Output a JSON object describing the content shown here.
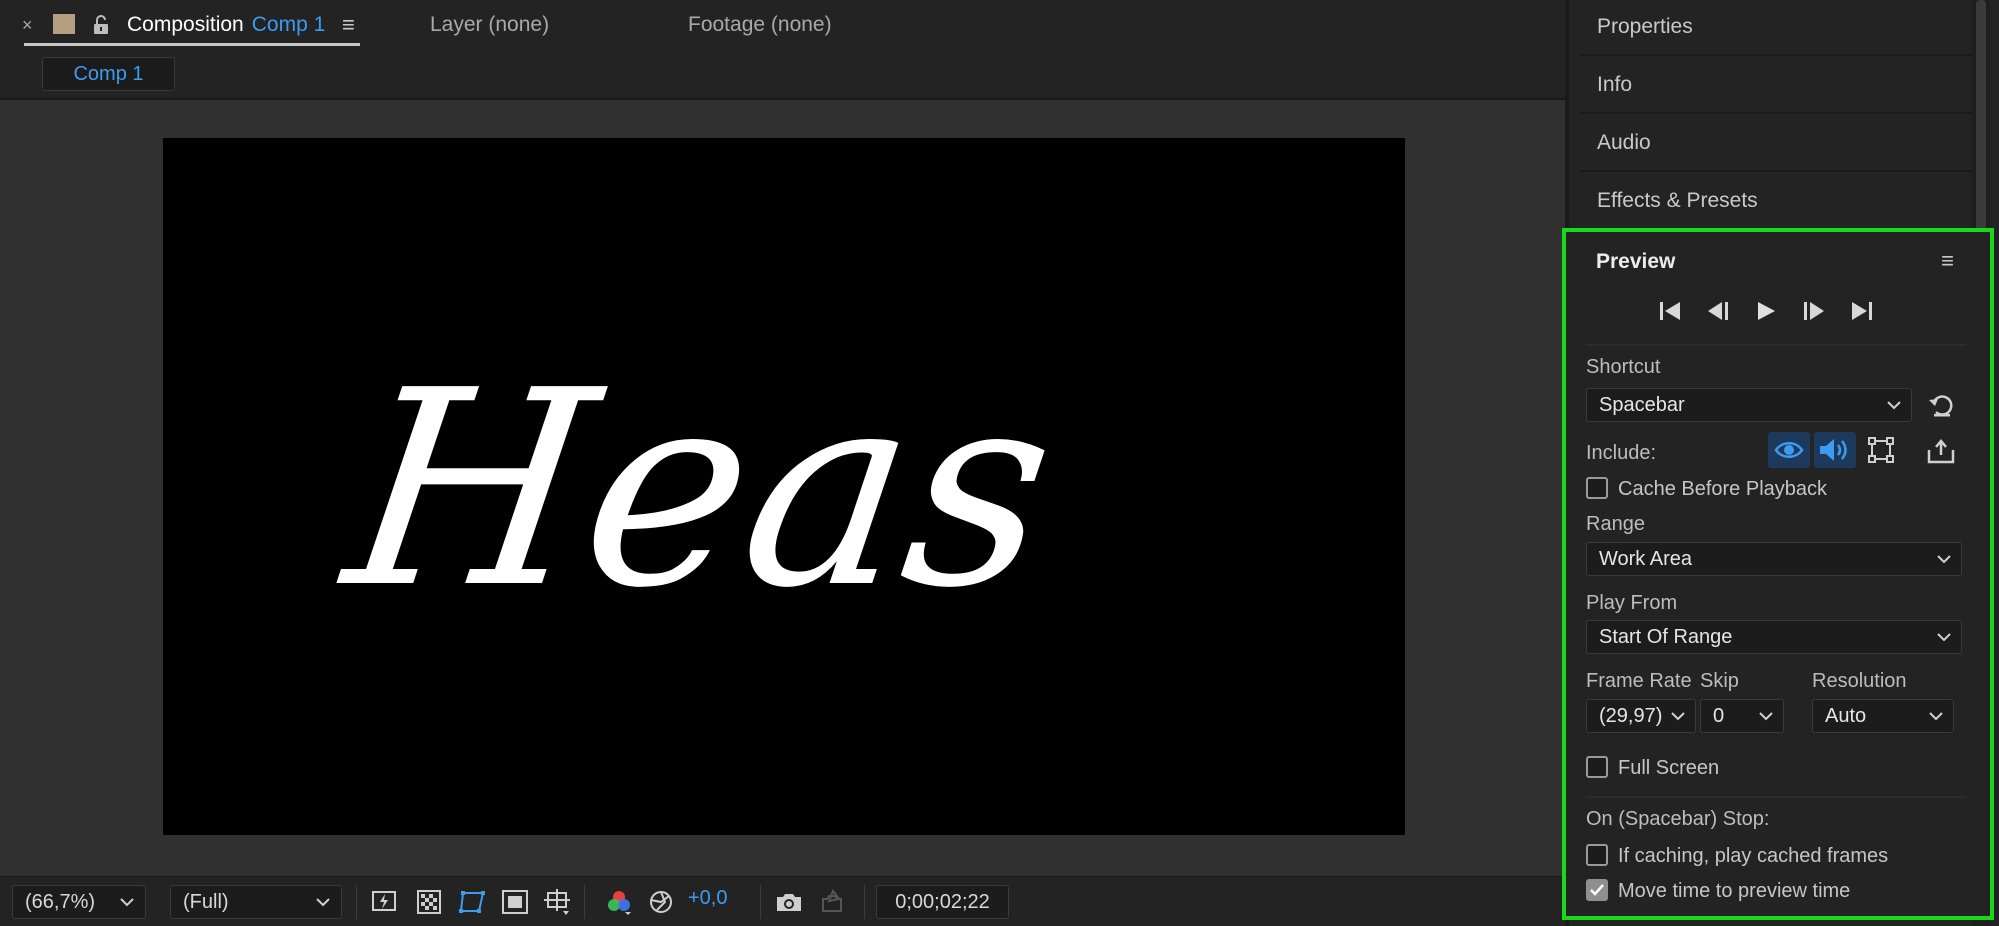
{
  "comp_panel": {
    "tabs": {
      "close": "×",
      "comp_prefix": "Composition",
      "comp_name": "Comp 1",
      "menu": "≡",
      "layer": "Layer (none)",
      "footage": "Footage (none)"
    },
    "subtab": "Comp 1",
    "canvas_text": "Heas"
  },
  "bottom_toolbar": {
    "zoom": "(66,7%)",
    "resolution": "(Full)",
    "exposure": "+0,0",
    "timecode": "0;00;02;22"
  },
  "right_panel": {
    "headers": [
      "Properties",
      "Info",
      "Audio",
      "Effects & Presets"
    ]
  },
  "preview": {
    "title": "Preview",
    "menu": "≡",
    "shortcut_label": "Shortcut",
    "shortcut_value": "Spacebar",
    "include_label": "Include:",
    "cache_before_playback": "Cache Before Playback",
    "range_label": "Range",
    "range_value": "Work Area",
    "play_from_label": "Play From",
    "play_from_value": "Start Of Range",
    "frame_rate_label": "Frame Rate",
    "skip_label": "Skip",
    "resolution_label": "Resolution",
    "frame_rate_value": "(29,97)",
    "skip_value": "0",
    "resolution_value": "Auto",
    "full_screen": "Full Screen",
    "on_stop_label": "On (Spacebar) Stop:",
    "if_caching": "If caching, play cached frames",
    "move_time": "Move time to preview time",
    "checks": {
      "cache_before_playback": false,
      "full_screen": false,
      "if_caching": false,
      "move_time": true
    },
    "highlight_color": "#1bd81b",
    "accent_color": "#3d9bf0"
  }
}
